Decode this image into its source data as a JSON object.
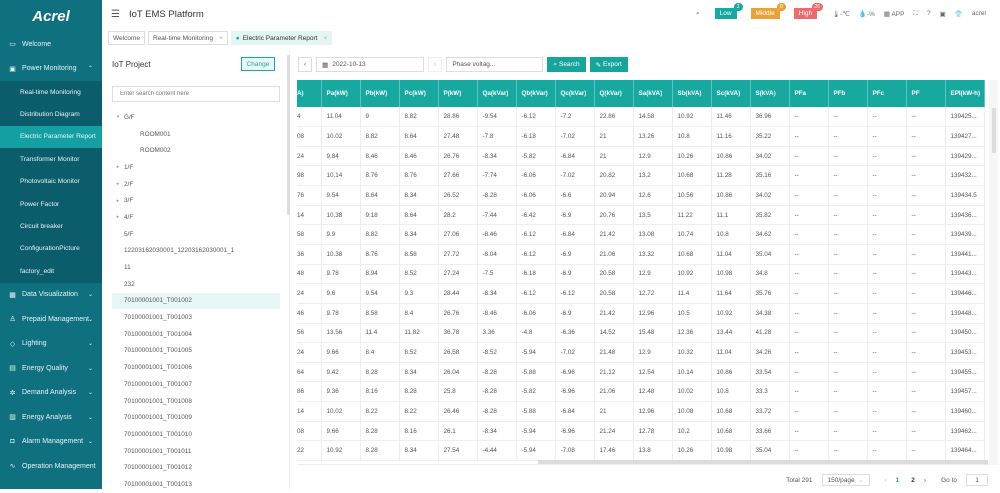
{
  "logo": "Acrel",
  "header": {
    "title": "IoT EMS Platform",
    "alarms": [
      {
        "label": "Low",
        "count": "2",
        "color": "#17a9a0"
      },
      {
        "label": "Middle",
        "count": "0",
        "color": "#e8a23a"
      },
      {
        "label": "High",
        "count": "26",
        "color": "#ef6b6b"
      }
    ],
    "temperature": "-℃",
    "humidity": "-%",
    "app_label": "APP",
    "user": "acrel"
  },
  "tabs": [
    {
      "label": "Welcome"
    },
    {
      "label": "Real-time Monitoring",
      "close": "×"
    },
    {
      "label": "Electric Parameter Report",
      "close": "×"
    }
  ],
  "sidebar": {
    "items": [
      {
        "label": "Welcome",
        "icon": "▭"
      },
      {
        "label": "Power Monitoring",
        "icon": "▣",
        "chev": "⌃",
        "children": [
          "Real-time Monitoring",
          "Distribution Diagram",
          "Electric Parameter Report",
          "Transformer Monitor",
          "Photovoltaic Monitor",
          "Power Factor",
          "Circuit breaker",
          "ConfigurationPicture",
          "factory_edit"
        ],
        "active_child": "Electric Parameter Report"
      },
      {
        "label": "Data Visualization",
        "icon": "▦",
        "chev": "⌄"
      },
      {
        "label": "Prepaid Management",
        "icon": "♙",
        "chev": "⌄"
      },
      {
        "label": "Lighting",
        "icon": "◇",
        "chev": "⌄"
      },
      {
        "label": "Energy Quality",
        "icon": "▤",
        "chev": "⌄"
      },
      {
        "label": "Demand Analysis",
        "icon": "✲",
        "chev": "⌄"
      },
      {
        "label": "Energy Analysis",
        "icon": "▥",
        "chev": "⌄"
      },
      {
        "label": "Alarm Management",
        "icon": "◘",
        "chev": "⌄"
      },
      {
        "label": "Operation Management",
        "icon": "∿"
      }
    ]
  },
  "tree": {
    "title": "IoT Project",
    "change_label": "Change",
    "search_placeholder": "Enter search content here",
    "nodes": [
      {
        "label": "G/F",
        "arrow": "▾",
        "level": 0
      },
      {
        "label": "ROOM001",
        "level": 1
      },
      {
        "label": "ROOM002",
        "level": 1
      },
      {
        "label": "1/F",
        "arrow": "▸",
        "level": 0
      },
      {
        "label": "2/F",
        "arrow": "▸",
        "level": 0
      },
      {
        "label": "3/F",
        "arrow": "▸",
        "level": 0
      },
      {
        "label": "4/F",
        "arrow": "▸",
        "level": 0
      },
      {
        "label": "5/F",
        "level": 0
      },
      {
        "label": "12203162030001_12203162030001_1",
        "level": 0
      },
      {
        "label": "11",
        "level": 0
      },
      {
        "label": "232",
        "level": 0
      },
      {
        "label": "70100001001_T001002",
        "level": 0,
        "selected": true
      },
      {
        "label": "70100001001_T001003",
        "level": 0
      },
      {
        "label": "70100001001_T001004",
        "level": 0
      },
      {
        "label": "70100001001_T001005",
        "level": 0
      },
      {
        "label": "70100001001_T001006",
        "level": 0
      },
      {
        "label": "70100001001_T001007",
        "level": 0
      },
      {
        "label": "70100001001_T001008",
        "level": 0
      },
      {
        "label": "70100001001_T001009",
        "level": 0
      },
      {
        "label": "70100001001_T001010",
        "level": 0
      },
      {
        "label": "70100001001_T001011",
        "level": 0
      },
      {
        "label": "70100001001_T001012",
        "level": 0
      },
      {
        "label": "70100001001_T001013",
        "level": 0
      }
    ]
  },
  "toolbar": {
    "date": "2022-10-13",
    "param_select": "Phase voltag...",
    "search_label": "Search",
    "export_label": "Export"
  },
  "table": {
    "columns": [
      "A)",
      "Pa(kW)",
      "Pb(kW)",
      "Pc(kW)",
      "P(kW)",
      "Qa(kVar)",
      "Qb(kVar)",
      "Qc(kVar)",
      "Q(kVar)",
      "Sa(kVA)",
      "Sb(kVA)",
      "Sc(kVA)",
      "S(kVA)",
      "PFa",
      "PFb",
      "PFc",
      "PF",
      "EPI(kW-h)"
    ],
    "rows": [
      [
        "4",
        "11.04",
        "9",
        "8.82",
        "28.86",
        "-9.54",
        "-6.12",
        "-7.2",
        "22.86",
        "14.58",
        "10.92",
        "11.46",
        "36.96",
        "--",
        "--",
        "--",
        "--",
        "139425..."
      ],
      [
        "08",
        "10.02",
        "8.82",
        "8.64",
        "27.48",
        "-7.8",
        "-6.18",
        "-7.02",
        "21",
        "13.26",
        "10.8",
        "11.16",
        "35.22",
        "--",
        "--",
        "--",
        "--",
        "139427..."
      ],
      [
        "24",
        "9.84",
        "8.46",
        "8.46",
        "26.76",
        "-8.34",
        "-5.82",
        "-6.84",
        "21",
        "12.9",
        "10.26",
        "10.86",
        "34.02",
        "--",
        "--",
        "--",
        "--",
        "139429..."
      ],
      [
        "98",
        "10.14",
        "8.76",
        "8.76",
        "27.66",
        "-7.74",
        "-6.06",
        "-7.02",
        "20.82",
        "13.2",
        "10.68",
        "11.28",
        "35.16",
        "--",
        "--",
        "--",
        "--",
        "139432..."
      ],
      [
        "76",
        "9.54",
        "8.64",
        "8.34",
        "26.52",
        "-8.28",
        "-6.06",
        "-6.6",
        "20.94",
        "12.6",
        "10.56",
        "10.86",
        "34.02",
        "--",
        "--",
        "--",
        "--",
        "139434.5"
      ],
      [
        "14",
        "10.38",
        "9.18",
        "8.64",
        "28.2",
        "-7.44",
        "-6.42",
        "-6.9",
        "20.76",
        "13.5",
        "11.22",
        "11.1",
        "35.82",
        "--",
        "--",
        "--",
        "--",
        "139436..."
      ],
      [
        "58",
        "9.9",
        "8.82",
        "8.34",
        "27.06",
        "-8.46",
        "-6.12",
        "-6.84",
        "21.42",
        "13.08",
        "10.74",
        "10.8",
        "34.62",
        "--",
        "--",
        "--",
        "--",
        "139439..."
      ],
      [
        "36",
        "10.38",
        "8.76",
        "8.58",
        "27.72",
        "-8.04",
        "-6.12",
        "-6.9",
        "21.06",
        "13.32",
        "10.68",
        "11.04",
        "35.04",
        "--",
        "--",
        "--",
        "--",
        "139441..."
      ],
      [
        "48",
        "9.78",
        "8.94",
        "8.52",
        "27.24",
        "-7.5",
        "-6.18",
        "-6.9",
        "20.58",
        "12.9",
        "10.92",
        "10.98",
        "34.8",
        "--",
        "--",
        "--",
        "--",
        "139443..."
      ],
      [
        "24",
        "9.6",
        "9.54",
        "9.3",
        "28.44",
        "-8.34",
        "-6.12",
        "-6.12",
        "20.58",
        "12.72",
        "11.4",
        "11.64",
        "35.76",
        "--",
        "--",
        "--",
        "--",
        "139446..."
      ],
      [
        "46",
        "9.78",
        "8.58",
        "8.4",
        "26.76",
        "-8.46",
        "-6.06",
        "-6.9",
        "21.42",
        "12.96",
        "10.5",
        "10.92",
        "34.38",
        "--",
        "--",
        "--",
        "--",
        "139448..."
      ],
      [
        "56",
        "13.56",
        "11.4",
        "11.82",
        "36.78",
        "3.36",
        "-4.8",
        "-6.36",
        "14.52",
        "15.48",
        "12.36",
        "13.44",
        "41.28",
        "--",
        "--",
        "--",
        "--",
        "139450..."
      ],
      [
        "24",
        "9.66",
        "8.4",
        "8.52",
        "26.58",
        "-8.52",
        "-5.94",
        "-7.02",
        "21.48",
        "12.9",
        "10.32",
        "11.04",
        "34.26",
        "--",
        "--",
        "--",
        "--",
        "139453..."
      ],
      [
        "64",
        "9.42",
        "8.28",
        "8.34",
        "26.04",
        "-8.28",
        "-5.88",
        "-6.96",
        "21.12",
        "12.54",
        "10.14",
        "10.86",
        "33.54",
        "--",
        "--",
        "--",
        "--",
        "139455..."
      ],
      [
        "86",
        "9.36",
        "8.16",
        "8.28",
        "25.8",
        "-8.28",
        "-5.82",
        "-6.96",
        "21.06",
        "12.48",
        "10.02",
        "10.8",
        "33.3",
        "--",
        "--",
        "--",
        "--",
        "139457..."
      ],
      [
        "14",
        "10.02",
        "8.22",
        "8.22",
        "26.46",
        "-8.28",
        "-5.88",
        "-6.84",
        "21",
        "12.96",
        "10.08",
        "10.68",
        "33.72",
        "--",
        "--",
        "--",
        "--",
        "139460..."
      ],
      [
        "08",
        "9.66",
        "8.28",
        "8.16",
        "26.1",
        "-8.34",
        "-5.94",
        "-6.96",
        "21.24",
        "12.78",
        "10.2",
        "10.68",
        "33.66",
        "--",
        "--",
        "--",
        "--",
        "139462..."
      ],
      [
        "22",
        "10.92",
        "8.28",
        "8.34",
        "27.54",
        "-4.44",
        "-5.94",
        "-7.08",
        "17.46",
        "13.8",
        "10.26",
        "10.98",
        "35.04",
        "--",
        "--",
        "--",
        "--",
        "139464..."
      ]
    ]
  },
  "pagination": {
    "total": "Total 291",
    "page_size": "150/page",
    "pages": [
      "1",
      "2"
    ],
    "current": "1",
    "goto_label": "Go to",
    "goto_value": "1",
    "prev": "‹",
    "next": "›"
  }
}
